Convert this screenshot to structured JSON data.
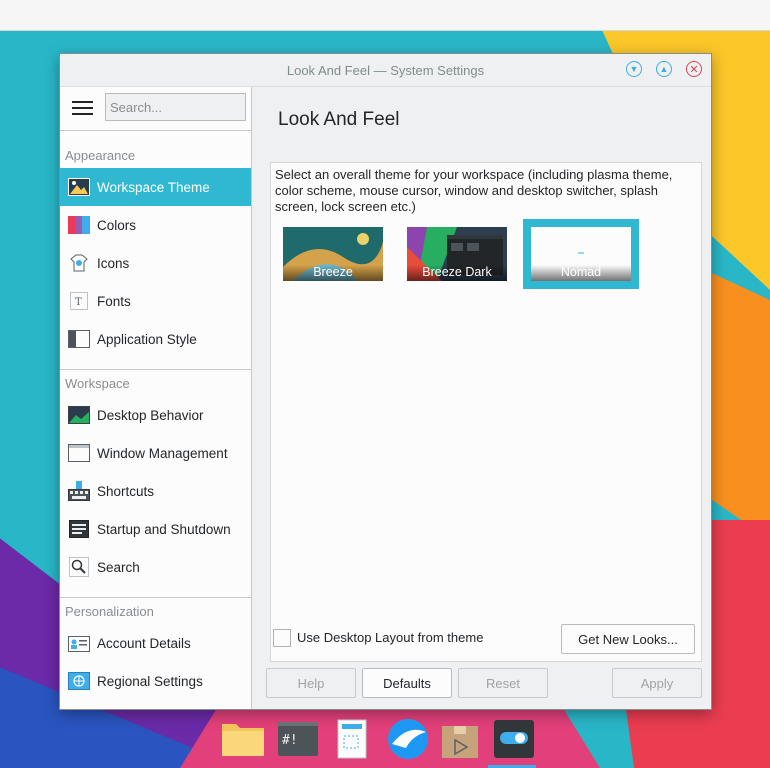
{
  "window": {
    "title": "Look And Feel — System Settings",
    "controls": {
      "minimize": "▼",
      "maximize": "▲",
      "close": "✕"
    }
  },
  "search": {
    "placeholder": "Search..."
  },
  "sidebar": {
    "sections": [
      {
        "header": "Appearance",
        "items": [
          {
            "label": "Workspace Theme",
            "icon": "workspace-theme-icon",
            "active": true
          },
          {
            "label": "Colors",
            "icon": "colors-icon"
          },
          {
            "label": "Icons",
            "icon": "icons-icon"
          },
          {
            "label": "Fonts",
            "icon": "fonts-icon"
          },
          {
            "label": "Application Style",
            "icon": "application-style-icon"
          }
        ]
      },
      {
        "header": "Workspace",
        "items": [
          {
            "label": "Desktop Behavior",
            "icon": "desktop-behavior-icon"
          },
          {
            "label": "Window Management",
            "icon": "window-management-icon"
          },
          {
            "label": "Shortcuts",
            "icon": "shortcuts-icon"
          },
          {
            "label": "Startup and Shutdown",
            "icon": "startup-shutdown-icon"
          },
          {
            "label": "Search",
            "icon": "search-settings-icon"
          }
        ]
      },
      {
        "header": "Personalization",
        "items": [
          {
            "label": "Account Details",
            "icon": "account-details-icon"
          },
          {
            "label": "Regional Settings",
            "icon": "regional-settings-icon"
          }
        ]
      }
    ]
  },
  "main": {
    "title": "Look And Feel",
    "description": "Select an overall theme for your workspace (including plasma theme, color scheme, mouse cursor, window and desktop switcher, splash screen, lock screen etc.)",
    "themes": [
      {
        "name": "Breeze",
        "selected": false
      },
      {
        "name": "Breeze Dark",
        "selected": false
      },
      {
        "name": "Nomad",
        "selected": true
      }
    ],
    "use_desktop_layout_label": "Use Desktop Layout from theme",
    "use_desktop_layout_checked": false,
    "get_new_looks_label": "Get New Looks..."
  },
  "footer": {
    "help": "Help",
    "defaults": "Defaults",
    "reset": "Reset",
    "apply": "Apply"
  },
  "taskbar": {
    "items": [
      {
        "name": "file-manager"
      },
      {
        "name": "terminal"
      },
      {
        "name": "screenshot-tool"
      },
      {
        "name": "discover"
      },
      {
        "name": "package-installer"
      },
      {
        "name": "system-settings",
        "active": true
      }
    ]
  },
  "colors": {
    "accent": "#30b8d2",
    "close": "#da4453",
    "window_bg": "#eff0f1"
  }
}
